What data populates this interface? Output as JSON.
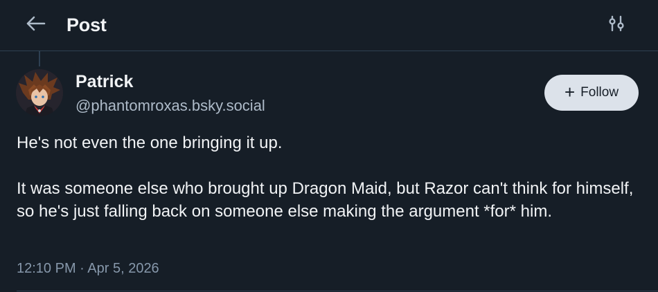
{
  "header": {
    "title": "Post",
    "back_icon": "arrow-left-icon",
    "settings_icon": "sliders-icon"
  },
  "author": {
    "name": "Patrick",
    "handle": "@phantomroxas.bsky.social"
  },
  "follow_button": {
    "icon": "+",
    "label": "Follow"
  },
  "post": {
    "paragraphs": [
      "He's not even the one bringing it up.",
      "It was someone else who brought up Dragon Maid, but Razor can't think for himself, so he's just falling back on someone else making the argument *for* him."
    ],
    "timestamp": "12:10 PM · Apr 5, 2026"
  },
  "colors": {
    "background": "#161e27",
    "divider": "#2e4052",
    "text_primary": "#f1f3f5",
    "text_secondary": "#aebbc9",
    "follow_bg": "#dce2ea"
  }
}
